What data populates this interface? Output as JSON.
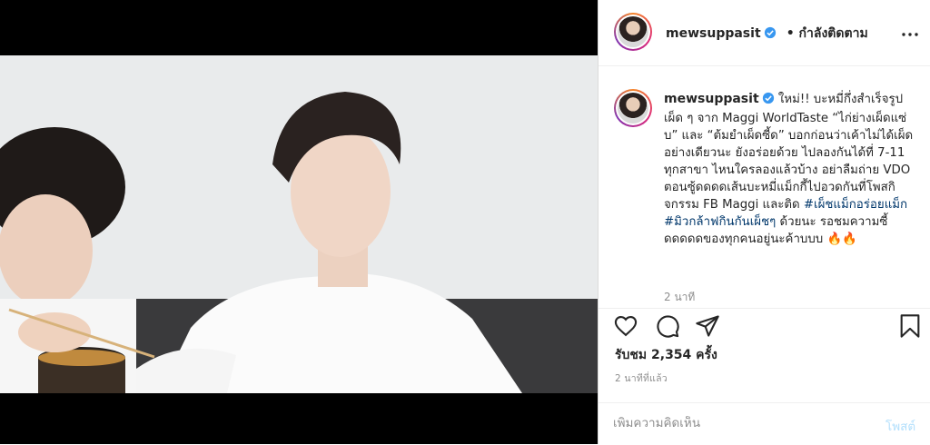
{
  "post": {
    "username": "mewsuppasit",
    "follow_status": "• กำลังติดตาม",
    "caption": {
      "username": "mewsuppasit",
      "text": " ใหม่!! บะหมี่กึ่งสำเร็จรูปเผ็ด ๆ จาก Maggi WorldTaste “ไก่ย่างเผ็ดแซ่บ” และ “ต้มยำเผ็ดซี้ด” บอกก่อนว่าเค้าไม่ได้เผ็ดอย่างเดียวนะ ยังอร่อยด้วย ไปลองกันได้ที่ 7-11 ทุกสาขา ไหนใครลองแล้วบ้าง อย่าลืมถ่าย VDO ตอนซู้ดดดดเส้นบะหมี่แม็กกี้ไปอวดกันที่โพสกิจกรรม FB Maggi และติด ",
      "hashtag1": "#เผ็ชแม็กอร่อยแม็ก",
      "hashtag2": "#มิวกล้าฟกินกันเผ็ชๆ",
      "text_end": " ด้วยนะ รอชมความซี้ดดดดดของทุกคนอยู่นะค้าบบบ 🔥🔥",
      "time": "2 นาที"
    },
    "views": "รับชม 2,354 ครั้ง",
    "ago": "2 นาทีที่แล้ว",
    "comment": {
      "placeholder": "เพิ่มความคิดเห็น",
      "post_label": "โพสต์"
    },
    "icons": {
      "more": "more-horizontal-icon",
      "mute": "speaker-muted-icon",
      "like": "heart-icon",
      "comment": "comment-bubble-icon",
      "share": "paper-plane-icon",
      "save": "bookmark-icon",
      "verified": "verified-badge-icon"
    },
    "colors": {
      "verified": "#3897f0",
      "hashtag": "#00376b",
      "muted_text": "#8e8e8e",
      "post_button": "#b2dffc"
    }
  }
}
